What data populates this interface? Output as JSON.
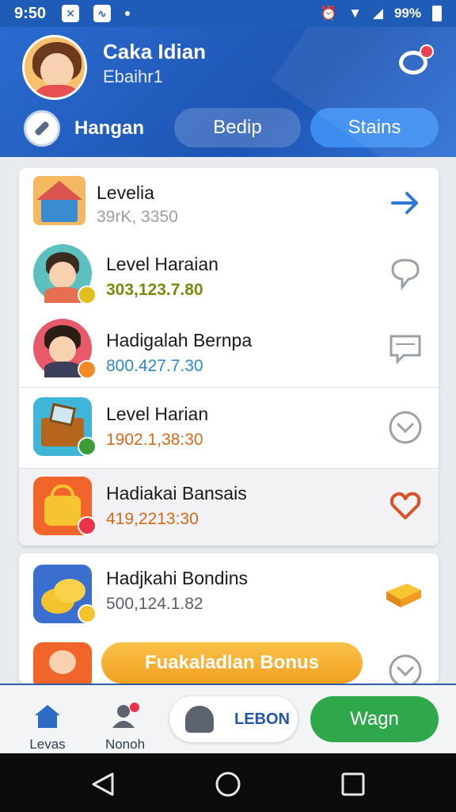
{
  "status_bar": {
    "time": "9:50",
    "battery": "99%"
  },
  "header": {
    "user_name": "Caka Idian",
    "user_sub": "Ebaihr1"
  },
  "tabs": [
    {
      "label": "Hangan"
    },
    {
      "label": "Bedip"
    },
    {
      "label": "Stains"
    }
  ],
  "list": [
    {
      "title": "Levelia",
      "value": "39rK, 3350",
      "value_color": "#9aa0a6"
    },
    {
      "title": "Level Haraian",
      "value": "303,123.7.80",
      "value_color": "#7a8a10"
    },
    {
      "title": "Hadigalah Bernpa",
      "value": "800.427.7.30",
      "value_color": "#2d8ac4"
    },
    {
      "title": "Level Harian",
      "value": "1902.1,38:30",
      "value_color": "#d2691e"
    },
    {
      "title": "Hadiakai Bansais",
      "value": "419,2213:30",
      "value_color": "#d26a1a"
    },
    {
      "title": "Hadjkahi Bondins",
      "value": "500,124.1.82",
      "value_color": "#5a5f66"
    }
  ],
  "bonus_button": {
    "label": "Fuakaladlan Bonus"
  },
  "bottom_nav": {
    "home_label": "Levas",
    "profile_label": "Nonoh",
    "lebon_label": "LEBON",
    "login_label": "Wagn"
  },
  "colors": {
    "header_blue": "#1e55b3",
    "accent_blue": "#3d8cf0",
    "login_green": "#2ea84a",
    "bonus_orange": "#f5a623"
  }
}
